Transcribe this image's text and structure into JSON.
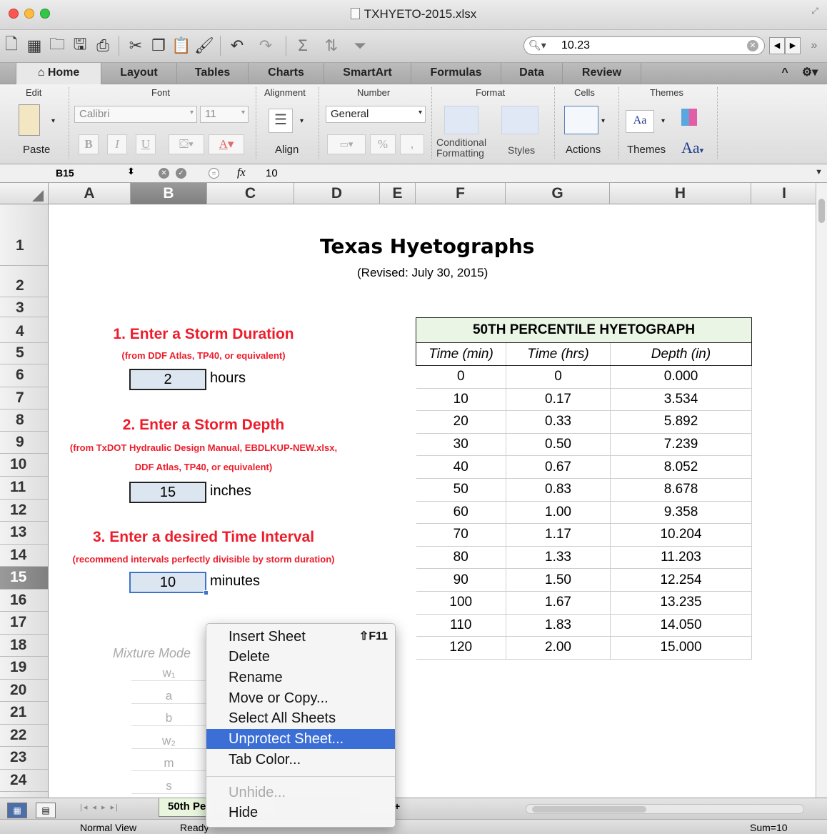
{
  "window": {
    "title": "TXHYETO-2015.xlsx",
    "colors": {
      "close": "#fc5753",
      "minimize": "#fdbc40",
      "zoom": "#33c748"
    }
  },
  "toolbar": {
    "icons": [
      "new-icon",
      "templates-icon",
      "open-icon",
      "save-icon",
      "print-icon",
      "cut-icon",
      "copy-icon",
      "paste-icon",
      "format-painter-icon",
      "undo-icon",
      "redo-icon",
      "autosum-icon",
      "sort-icon",
      "filter-icon"
    ],
    "search_value": "10.23"
  },
  "ribbon_tabs": [
    "Home",
    "Layout",
    "Tables",
    "Charts",
    "SmartArt",
    "Formulas",
    "Data",
    "Review"
  ],
  "ribbon": {
    "edit": {
      "title": "Edit",
      "paste_label": "Paste"
    },
    "font": {
      "title": "Font",
      "name": "Calibri",
      "size": "11",
      "bold": "B",
      "italic": "I",
      "underline": "U",
      "font_color": "A"
    },
    "alignment": {
      "title": "Alignment",
      "align_label": "Align"
    },
    "number": {
      "title": "Number",
      "format": "General",
      "percent": "%",
      "comma": "̹"
    },
    "format": {
      "title": "Format",
      "conditional_label": "Conditional Formatting",
      "styles_label": "Styles"
    },
    "cells": {
      "title": "Cells",
      "actions_label": "Actions"
    },
    "themes": {
      "title": "Themes",
      "themes_label": "Themes",
      "aa": "Aa",
      "aa_small": "Aa"
    }
  },
  "formula_bar": {
    "name_box": "B15",
    "fx": "fx",
    "value": "10"
  },
  "columns": [
    "A",
    "B",
    "C",
    "D",
    "E",
    "F",
    "G",
    "H",
    "I"
  ],
  "rows": [
    "1",
    "2",
    "3",
    "4",
    "5",
    "6",
    "7",
    "8",
    "9",
    "10",
    "11",
    "12",
    "13",
    "14",
    "15",
    "16",
    "17",
    "18",
    "19",
    "20",
    "21",
    "22",
    "23",
    "24"
  ],
  "sheet": {
    "title": "Texas Hyetographs",
    "subtitle": "(Revised: July 30, 2015)",
    "step1": {
      "heading": "1.  Enter a Storm Duration",
      "note": "(from DDF Atlas, TP40, or equivalent)",
      "value": "2",
      "unit": "hours"
    },
    "step2": {
      "heading": "2.  Enter a Storm Depth",
      "note1": "(from TxDOT Hydraulic Design Manual, EBDLKUP-NEW.xlsx,",
      "note2": "DDF Atlas, TP40, or equivalent)",
      "value": "15",
      "unit": "inches"
    },
    "step3": {
      "heading": "3. Enter a desired Time Interval",
      "note": "(recommend intervals perfectly divisible by storm duration)",
      "value": "10",
      "unit": "minutes"
    },
    "mixture_label": "Mixture Mode",
    "mixture_params": [
      "w₁",
      "a",
      "b",
      "w₂",
      "m",
      "s"
    ]
  },
  "hyetograph": {
    "title": "50TH PERCENTILE HYETOGRAPH",
    "headers": [
      "Time (min)",
      "Time (hrs)",
      "Depth (in)"
    ],
    "rows": [
      [
        "0",
        "0",
        "0.000"
      ],
      [
        "10",
        "0.17",
        "3.534"
      ],
      [
        "20",
        "0.33",
        "5.892"
      ],
      [
        "30",
        "0.50",
        "7.239"
      ],
      [
        "40",
        "0.67",
        "8.052"
      ],
      [
        "50",
        "0.83",
        "8.678"
      ],
      [
        "60",
        "1.00",
        "9.358"
      ],
      [
        "70",
        "1.17",
        "10.204"
      ],
      [
        "80",
        "1.33",
        "11.203"
      ],
      [
        "90",
        "1.50",
        "12.254"
      ],
      [
        "100",
        "1.67",
        "13.235"
      ],
      [
        "110",
        "1.83",
        "14.050"
      ],
      [
        "120",
        "2.00",
        "15.000"
      ]
    ]
  },
  "context_menu": {
    "items": [
      {
        "label": "Insert Sheet",
        "shortcut": "⇧F11"
      },
      {
        "label": "Delete"
      },
      {
        "label": "Rename"
      },
      {
        "label": "Move or Copy..."
      },
      {
        "label": "Select All Sheets"
      },
      {
        "label": "Unprotect Sheet..."
      },
      {
        "label": "Tab Color..."
      },
      {
        "label": "Unhide..."
      },
      {
        "label": "Hide"
      }
    ],
    "highlight_color": "#3b6fd6"
  },
  "sheet_tabs": {
    "active": "50th Pe"
  },
  "status": {
    "view": "Normal View",
    "state": "Ready",
    "sum": "Sum=10"
  }
}
